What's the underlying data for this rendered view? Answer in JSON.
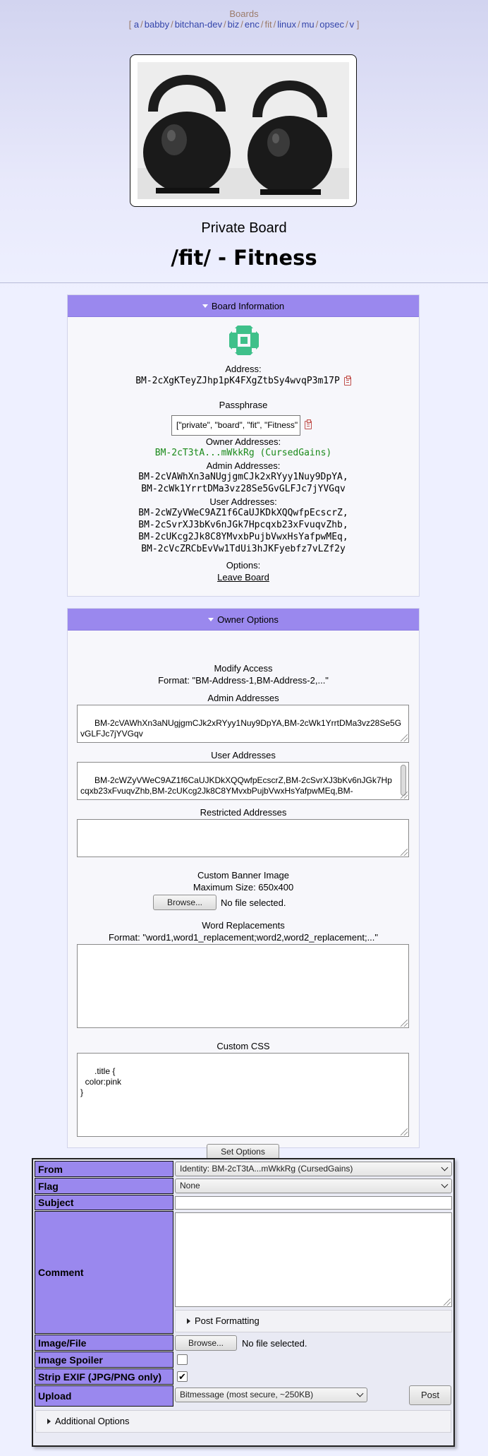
{
  "nav": {
    "title": "Boards",
    "open_bracket": "[",
    "close_bracket": "]",
    "boards": [
      "a",
      "babby",
      "bitchan-dev",
      "biz",
      "enc",
      "fit",
      "linux",
      "mu",
      "opsec",
      "v"
    ],
    "current": "fit"
  },
  "header": {
    "private_label": "Private Board",
    "board_title": "/fit/ - Fitness"
  },
  "board_info": {
    "toggle_label": "Board Information",
    "address_label": "Address:",
    "address": "BM-2cXgKTeyZJhp1pK4FXgZtbSy4wvqP3m17P",
    "passphrase_label": "Passphrase",
    "passphrase": "[\"private\", \"board\", \"fit\", \"Fitness\"",
    "owner_label": "Owner Addresses:",
    "owner": "BM-2cT3tA...mWkkRg (CursedGains)",
    "admin_label": "Admin Addresses:",
    "admins": [
      "BM-2cVAWhXn3aNUgjgmCJk2xRYyy1Nuy9DpYA,",
      "BM-2cWk1YrrtDMa3vz28Se5GvGLFJc7jYVGqv"
    ],
    "user_label": "User Addresses:",
    "users": [
      "BM-2cWZyVWeC9AZ1f6CaUJKDkXQQwfpEcscrZ,",
      "BM-2cSvrXJ3bKv6nJGk7Hpcqxb23xFvuqvZhb,",
      "BM-2cUKcg2Jk8C8YMvxbPujbVwxHsYafpwMEq,",
      "BM-2cVcZRCbEvVw1TdUi3hJKFyebfz7vLZf2y"
    ],
    "options_label": "Options:",
    "leave_link": "Leave Board"
  },
  "owner_options": {
    "toggle_label": "Owner Options",
    "modify_access_label": "Modify Access",
    "modify_access_format": "Format: \"BM-Address-1,BM-Address-2,...\"",
    "admin_addresses_label": "Admin Addresses",
    "admin_addresses_value": "BM-2cVAWhXn3aNUgjgmCJk2xRYyy1Nuy9DpYA,BM-2cWk1YrrtDMa3vz28Se5GvGLFJc7jYVGqv",
    "user_addresses_label": "User Addresses",
    "user_addresses_value": "BM-2cWZyVWeC9AZ1f6CaUJKDkXQQwfpEcscrZ,BM-2cSvrXJ3bKv6nJGk7Hpcqxb23xFvuqvZhb,BM-2cUKcg2Jk8C8YMvxbPujbVwxHsYafpwMEq,BM-",
    "restricted_addresses_label": "Restricted Addresses",
    "restricted_addresses_value": "",
    "banner_label": "Custom Banner Image",
    "banner_max_size": "Maximum Size: 650x400",
    "browse_label": "Browse...",
    "no_file": "No file selected.",
    "word_replacements_label": "Word Replacements",
    "word_replacements_format": "Format: \"word1,word1_replacement;word2,word2_replacement;...\"",
    "word_replacements_value": "",
    "custom_css_label": "Custom CSS",
    "custom_css_value": ".title {\n  color:pink\n}",
    "set_options_button": "Set Options"
  },
  "post_form": {
    "from_label": "From",
    "from_value": "Identity: BM-2cT3tA...mWkkRg (CursedGains)",
    "flag_label": "Flag",
    "flag_value": "None",
    "subject_label": "Subject",
    "subject_value": "",
    "comment_label": "Comment",
    "comment_value": "",
    "post_formatting_label": "Post Formatting",
    "image_file_label": "Image/File",
    "browse_label": "Browse...",
    "no_file": "No file selected.",
    "image_spoiler_label": "Image Spoiler",
    "image_spoiler_checked": false,
    "strip_exif_label": "Strip EXIF (JPG/PNG only)",
    "strip_exif_checked": true,
    "upload_label": "Upload",
    "upload_value": "Bitmessage (most secure, ~250KB)",
    "post_button": "Post",
    "additional_options_label": "Additional Options"
  },
  "colors": {
    "accent": "#9a88ee",
    "link": "#3344aa",
    "owner_green": "#1a8a1a"
  }
}
